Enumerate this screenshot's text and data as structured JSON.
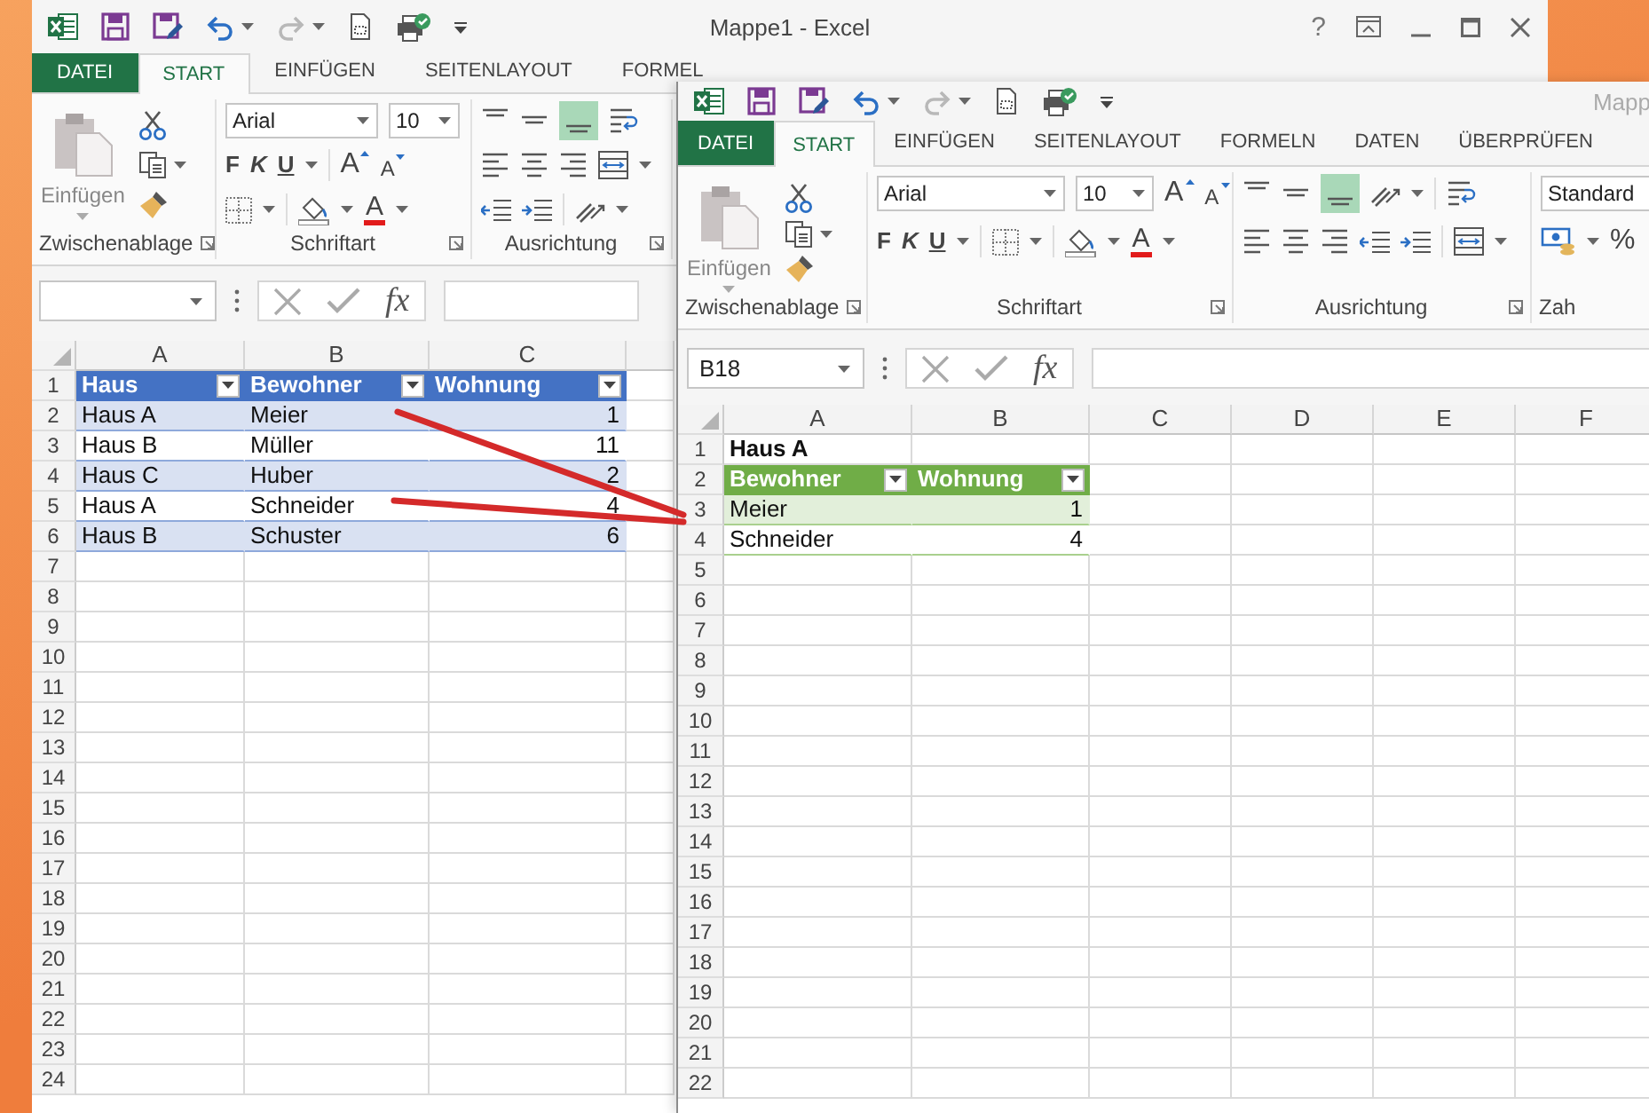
{
  "back_window": {
    "title": "Mappe1 - Excel",
    "help": "?",
    "tabs": [
      {
        "label": "DATEI",
        "kind": "file",
        "selected": false
      },
      {
        "label": "START",
        "kind": "tab",
        "selected": true
      },
      {
        "label": "EINFÜGEN",
        "kind": "tab",
        "selected": false
      },
      {
        "label": "SEITENLAYOUT",
        "kind": "tab",
        "selected": false
      },
      {
        "label": "FORMEL",
        "kind": "tab",
        "selected": false
      }
    ],
    "ribbon": {
      "paste": "Einfügen",
      "font": "Arial",
      "size": "10",
      "bold": "F",
      "italic": "K",
      "underline": "U",
      "grow": "A",
      "shrink": "A",
      "font_color": "A",
      "bottom_aligned": true,
      "groups": [
        "Zwischenablage",
        "Schriftart",
        "Ausrichtung"
      ]
    },
    "fx": "fx",
    "columns": [
      "A",
      "B",
      "C"
    ],
    "rows": [
      {
        "number": "1",
        "cells": [
          {
            "text": "Haus",
            "kind": "header",
            "filter": true
          },
          {
            "text": "Bewohner",
            "kind": "header",
            "filter": true
          },
          {
            "text": "Wohnung",
            "kind": "header",
            "filter": true
          }
        ]
      },
      {
        "number": "2",
        "cells": [
          {
            "text": "Haus A",
            "kind": "band"
          },
          {
            "text": "Meier",
            "kind": "band"
          },
          {
            "text": "1",
            "kind": "band",
            "numeric": true
          }
        ]
      },
      {
        "number": "3",
        "cells": [
          {
            "text": "Haus B",
            "kind": "row"
          },
          {
            "text": "Müller",
            "kind": "row"
          },
          {
            "text": "11",
            "kind": "row",
            "numeric": true
          }
        ]
      },
      {
        "number": "4",
        "cells": [
          {
            "text": "Haus C",
            "kind": "band"
          },
          {
            "text": "Huber",
            "kind": "band"
          },
          {
            "text": "2",
            "kind": "band",
            "numeric": true
          }
        ]
      },
      {
        "number": "5",
        "cells": [
          {
            "text": "Haus A",
            "kind": "row"
          },
          {
            "text": "Schneider",
            "kind": "row"
          },
          {
            "text": "4",
            "kind": "row",
            "numeric": true
          }
        ]
      },
      {
        "number": "6",
        "cells": [
          {
            "text": "Haus B",
            "kind": "band"
          },
          {
            "text": "Schuster",
            "kind": "band"
          },
          {
            "text": "6",
            "kind": "band",
            "numeric": true
          }
        ]
      },
      {
        "number": "7"
      },
      {
        "number": "8"
      },
      {
        "number": "9"
      },
      {
        "number": "10"
      },
      {
        "number": "11"
      },
      {
        "number": "12"
      },
      {
        "number": "13"
      },
      {
        "number": "14"
      },
      {
        "number": "15"
      },
      {
        "number": "16"
      },
      {
        "number": "17"
      },
      {
        "number": "18"
      },
      {
        "number": "19"
      },
      {
        "number": "20"
      },
      {
        "number": "21"
      },
      {
        "number": "22"
      },
      {
        "number": "23"
      },
      {
        "number": "24"
      }
    ]
  },
  "front_window": {
    "title": "Mapp",
    "tabs": [
      {
        "label": "DATEI",
        "kind": "file",
        "selected": false
      },
      {
        "label": "START",
        "kind": "tab",
        "selected": true
      },
      {
        "label": "EINFÜGEN",
        "kind": "tab",
        "selected": false
      },
      {
        "label": "SEITENLAYOUT",
        "kind": "tab",
        "selected": false
      },
      {
        "label": "FORMELN",
        "kind": "tab",
        "selected": false
      },
      {
        "label": "DATEN",
        "kind": "tab",
        "selected": false
      },
      {
        "label": "ÜBERPRÜFEN",
        "kind": "tab",
        "selected": false
      }
    ],
    "ribbon": {
      "paste": "Einfügen",
      "font": "Arial",
      "size": "10",
      "bold": "F",
      "italic": "K",
      "underline": "U",
      "grow": "A",
      "shrink": "A",
      "font_color": "A",
      "bottom_aligned": true,
      "number_format": "Standard",
      "percent": "%",
      "groups": [
        "Zwischenablage",
        "Schriftart",
        "Ausrichtung",
        "Zah"
      ]
    },
    "name_box": "B18",
    "fx": "fx",
    "columns": [
      "A",
      "B",
      "C",
      "D",
      "E",
      "F"
    ],
    "rows": [
      {
        "number": "1",
        "cells": [
          {
            "text": "Haus A",
            "kind": "bold"
          }
        ]
      },
      {
        "number": "2",
        "cells": [
          {
            "text": "Bewohner",
            "kind": "header",
            "filter": true
          },
          {
            "text": "Wohnung",
            "kind": "header",
            "filter": true
          }
        ]
      },
      {
        "number": "3",
        "cells": [
          {
            "text": "Meier",
            "kind": "band"
          },
          {
            "text": "1",
            "kind": "band",
            "numeric": true
          }
        ]
      },
      {
        "number": "4",
        "cells": [
          {
            "text": "Schneider",
            "kind": "row"
          },
          {
            "text": "4",
            "kind": "row",
            "numeric": true
          }
        ]
      },
      {
        "number": "5"
      },
      {
        "number": "6"
      },
      {
        "number": "7"
      },
      {
        "number": "8"
      },
      {
        "number": "9"
      },
      {
        "number": "10"
      },
      {
        "number": "11"
      },
      {
        "number": "12"
      },
      {
        "number": "13"
      },
      {
        "number": "14"
      },
      {
        "number": "15"
      },
      {
        "number": "16"
      },
      {
        "number": "17"
      },
      {
        "number": "18"
      },
      {
        "number": "19"
      },
      {
        "number": "20"
      },
      {
        "number": "21"
      },
      {
        "number": "22"
      }
    ]
  }
}
